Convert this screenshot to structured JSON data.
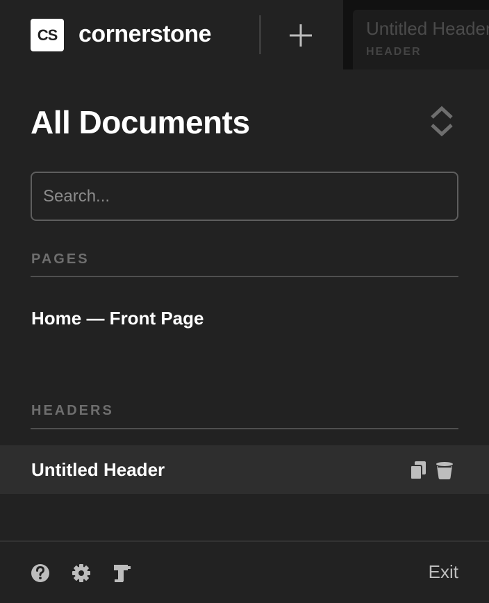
{
  "brand": {
    "badge": "CS",
    "name": "cornerstone"
  },
  "preview": {
    "title": "Untitled Header",
    "subtitle": "HEADER"
  },
  "panel": {
    "title": "All Documents"
  },
  "search": {
    "placeholder": "Search...",
    "value": ""
  },
  "sections": [
    {
      "label": "PAGES",
      "items": [
        {
          "label": "Home — Front Page"
        }
      ]
    },
    {
      "label": "HEADERS",
      "items": [
        {
          "label": "Untitled Header"
        }
      ]
    }
  ],
  "footer": {
    "exit_label": "Exit"
  },
  "icons": {
    "add": "plus-icon",
    "sort": "sort-icon",
    "duplicate": "copy-icon",
    "delete": "trash-icon",
    "help": "help-icon",
    "settings": "gear-icon",
    "tools": "builder-tool-icon"
  },
  "colors": {
    "background": "#222222",
    "preview_background": "#111111",
    "active_row": "#2e2e2e",
    "text": "#ffffff",
    "muted_text": "#6e6e6e",
    "icon": "#bdbdbd"
  }
}
